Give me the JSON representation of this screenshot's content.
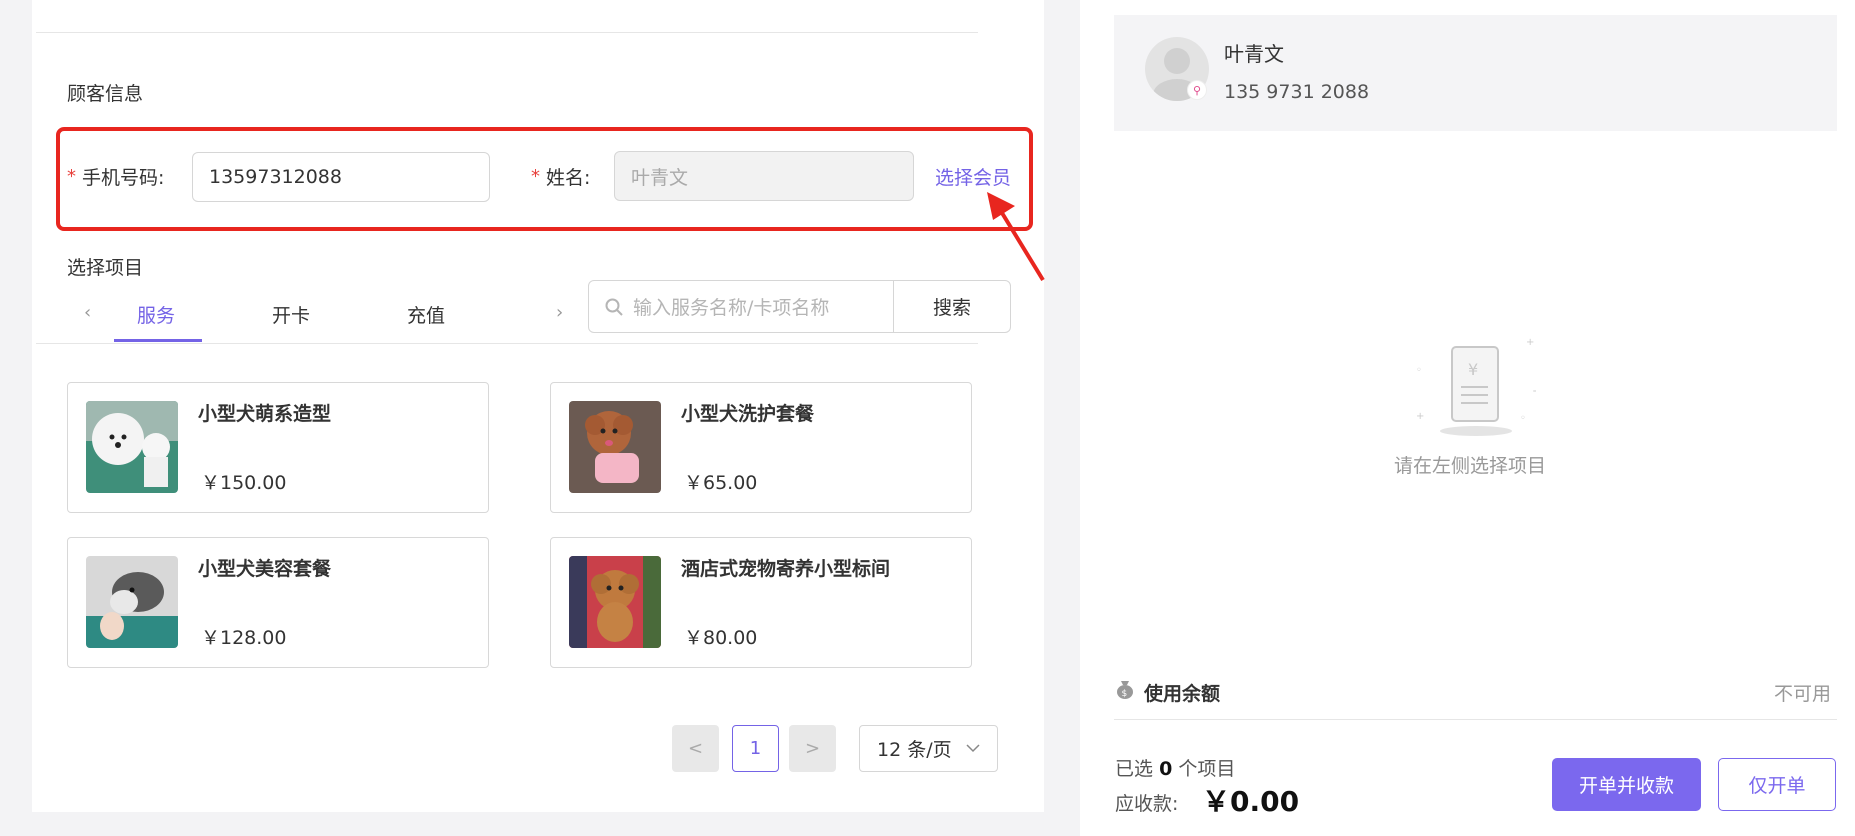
{
  "customer": {
    "section_title": "顾客信息",
    "phone_label": "手机号码:",
    "phone_value": "13597312088",
    "name_label": "姓名:",
    "name_placeholder": "叶青文",
    "required_mark": "*",
    "select_member_link": "选择会员"
  },
  "projects": {
    "section_title": "选择项目",
    "tabs": [
      {
        "label": "服务",
        "active": true
      },
      {
        "label": "开卡",
        "active": false
      },
      {
        "label": "充值",
        "active": false
      }
    ],
    "search": {
      "placeholder": "输入服务名称/卡项名称",
      "button": "搜索"
    },
    "items": [
      {
        "name": "小型犬萌系造型",
        "price": "￥150.00"
      },
      {
        "name": "小型犬洗护套餐",
        "price": "￥65.00"
      },
      {
        "name": "小型犬美容套餐",
        "price": "￥128.00"
      },
      {
        "name": "酒店式宠物寄养小型标间",
        "price": "￥80.00"
      }
    ]
  },
  "pagination": {
    "prev": "<",
    "current": "1",
    "next": ">",
    "page_size": "12 条/页"
  },
  "member": {
    "name": "叶青文",
    "phone": "135 9731 2088"
  },
  "cart": {
    "empty_text": "请在左侧选择项目"
  },
  "checkout": {
    "balance_label": "使用余额",
    "balance_status": "不可用",
    "selected_prefix": "已选",
    "selected_count": "0",
    "selected_suffix": "个项目",
    "due_label": "应收款:",
    "due_amount": "￥0.00",
    "submit_pay": "开单并收款",
    "submit_only": "仅开单"
  },
  "colors": {
    "accent": "#7463e6",
    "highlight": "#e8261f"
  }
}
